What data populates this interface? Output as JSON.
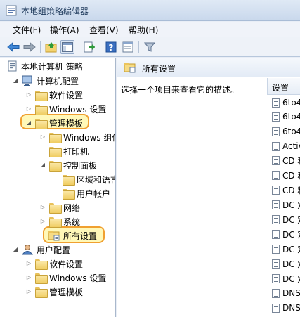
{
  "window": {
    "title": "本地组策略编辑器"
  },
  "menu": [
    "文件(F)",
    "操作(A)",
    "查看(V)",
    "帮助(H)"
  ],
  "toolbar": [
    "back-icon",
    "forward-icon",
    "up-folder-icon",
    "show-hide-tree-icon",
    "export-list-icon",
    "help-icon",
    "properties-icon",
    "filter-icon"
  ],
  "tree": {
    "root": "本地计算机 策略",
    "computer_config": "计算机配置",
    "software_settings": "软件设置",
    "windows_settings": "Windows 设置",
    "admin_templates": "管理模板",
    "windows_components": "Windows 组件",
    "printers": "打印机",
    "control_panel": "控制面板",
    "regional_language": "区域和语言",
    "user_accounts": "用户帐户",
    "network": "网络",
    "system": "系统",
    "all_settings": "所有设置",
    "user_config": "用户配置",
    "u_software_settings": "软件设置",
    "u_windows_settings": "Windows 设置",
    "u_admin_templates": "管理模板"
  },
  "right": {
    "header": "所有设置",
    "description": "选择一个项目来查看它的描述。",
    "column": "设置",
    "rows": [
      "6to4",
      "6to4",
      "6to4",
      "Activ",
      "CD 和",
      "CD 和",
      "CD 和",
      "DC 定",
      "DC 定",
      "DC 定",
      "DC 定",
      "DC 定",
      "DC 定",
      "DNS",
      "DNS"
    ]
  }
}
